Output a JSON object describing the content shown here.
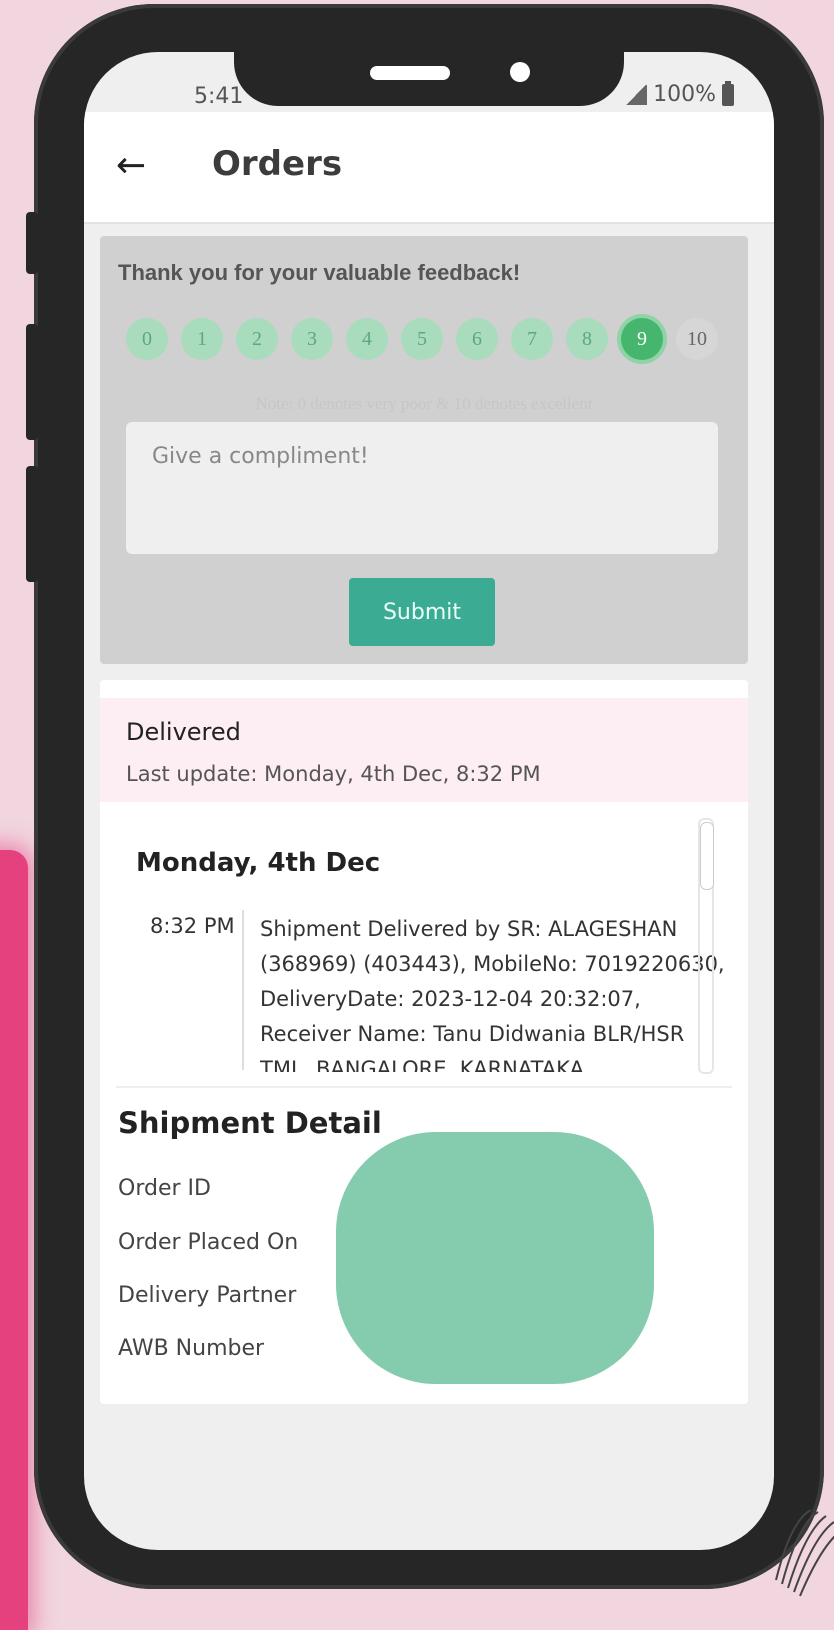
{
  "status_bar": {
    "time": "5:41",
    "battery": "100%"
  },
  "app_bar": {
    "title": "Orders",
    "back_icon": "arrow-left-icon"
  },
  "feedback": {
    "thanks": "Thank you for your valuable feedback!",
    "scores": [
      "0",
      "1",
      "2",
      "3",
      "4",
      "5",
      "6",
      "7",
      "8",
      "9",
      "10"
    ],
    "selected": "9",
    "note": "Note: 0 denotes very poor & 10 denotes excellent",
    "placeholder": "Give a compliment!",
    "submit_label": "Submit"
  },
  "tracking": {
    "status": "Delivered",
    "last_update": "Last update: Monday, 4th Dec, 8:32 PM",
    "day": "Monday, 4th Dec",
    "events": [
      {
        "time": "8:32 PM",
        "text": "Shipment Delivered by SR: ALAGESHAN (368969) (403443), MobileNo: 7019220630, DeliveryDate: 2023-12-04 20:32:07, Receiver Name: Tanu Didwania BLR/HSR TML, BANGALORE, KARNATAKA"
      }
    ]
  },
  "shipment_detail": {
    "title": "Shipment Detail",
    "rows": [
      "Order ID",
      "Order Placed On",
      "Delivery Partner",
      "AWB Number"
    ]
  },
  "colors": {
    "accent": "#3bab94",
    "selected_score": "#46b66e",
    "banner": "#fceef2",
    "redaction": "#85ccaf"
  }
}
